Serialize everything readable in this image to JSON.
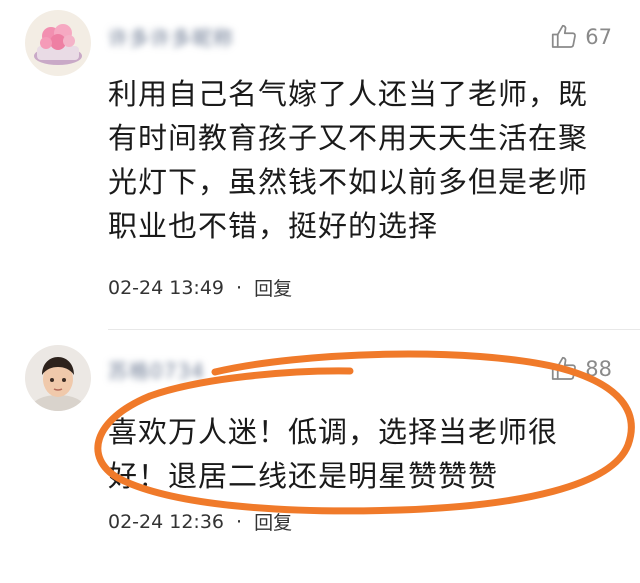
{
  "comments": [
    {
      "username": "许多许多昵称",
      "likes": "67",
      "text": "利用自己名气嫁了人还当了老师，既有时间教育孩子又不用天天生活在聚光灯下，虽然钱不如以前多但是老师职业也不错，挺好的选择",
      "timestamp": "02-24 13:49",
      "separator": "·",
      "reply_label": "回复"
    },
    {
      "username": "苏格0734",
      "likes": "88",
      "text": "喜欢万人迷！低调，选择当老师很好！退居二线还是明星赞赞赞",
      "timestamp": "02-24 12:36",
      "separator": "·",
      "reply_label": "回复"
    }
  ],
  "colors": {
    "annotation": "#f07a2a",
    "username": "#6c7a93",
    "meta": "#333333",
    "like_icon": "#8a8a8a"
  }
}
